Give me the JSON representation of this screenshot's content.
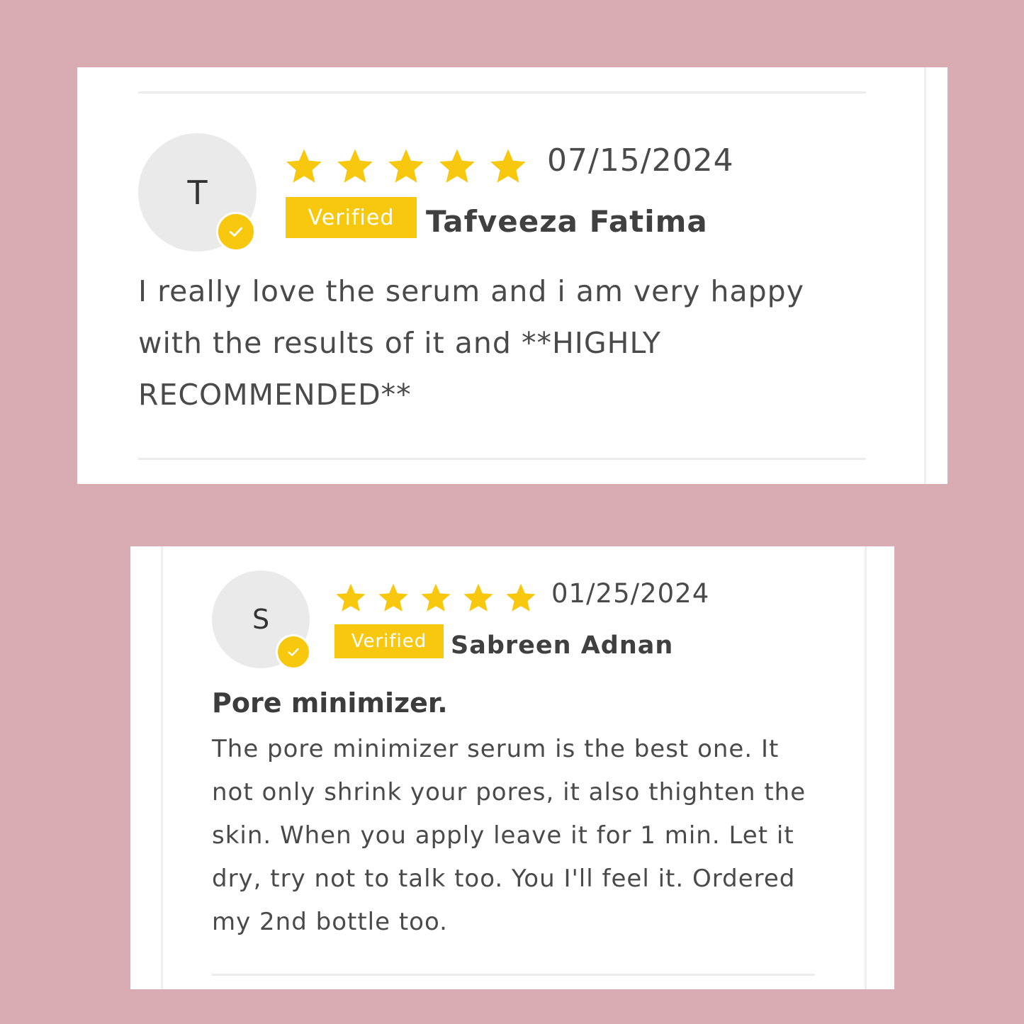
{
  "colors": {
    "page_background": "#d9acb4",
    "card_background": "#ffffff",
    "accent_yellow": "#f8c80e",
    "text": "#4a4a4a",
    "avatar_background": "#eaeaea"
  },
  "reviews": [
    {
      "avatar_initial": "T",
      "rating": 5,
      "rating_max": 5,
      "star_icon": "star-icon",
      "check_icon": "check-icon",
      "date": "07/15/2024",
      "verified_label": "Verified",
      "reviewer_name": "Tafveeza Fatima",
      "title": "",
      "body": "I really love the serum and i am very happy with the results of it and **HIGHLY RECOMMENDED**"
    },
    {
      "avatar_initial": "S",
      "rating": 5,
      "rating_max": 5,
      "star_icon": "star-icon",
      "check_icon": "check-icon",
      "date": "01/25/2024",
      "verified_label": "Verified",
      "reviewer_name": "Sabreen Adnan",
      "title": "Pore minimizer.",
      "body": "The pore minimizer serum is the best one. It not only shrink your pores, it also thighten the skin. When you apply leave it for 1 min. Let it dry, try not to talk too. You I'll feel it. Ordered my 2nd bottle too."
    }
  ]
}
